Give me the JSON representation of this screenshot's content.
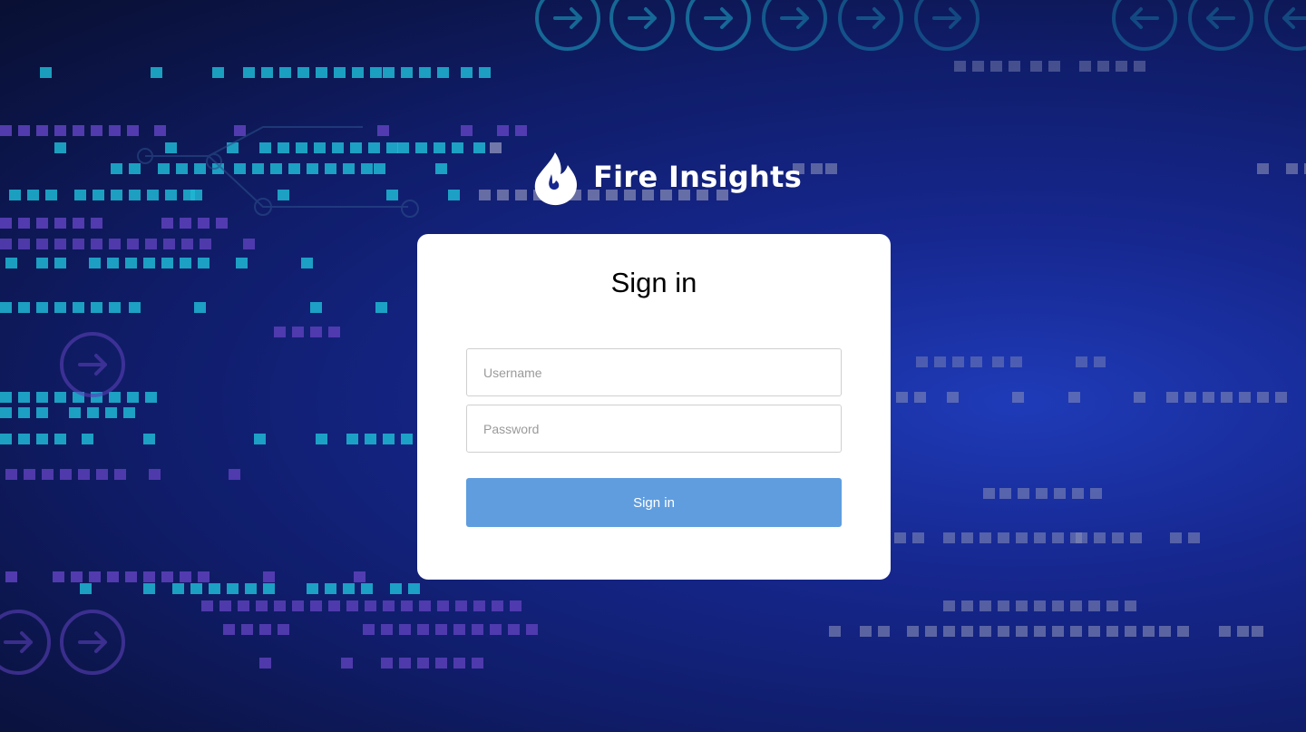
{
  "brand": {
    "name": "Fire Insights",
    "logo_icon": "flame-icon"
  },
  "login": {
    "title": "Sign in",
    "username_placeholder": "Username",
    "password_placeholder": "Password",
    "submit_label": "Sign in"
  },
  "colors": {
    "background": "#101d6b",
    "card": "#ffffff",
    "button": "#5f9ddf",
    "accent_cyan": "#1fb7d4",
    "accent_purple": "#5a3fb8"
  }
}
